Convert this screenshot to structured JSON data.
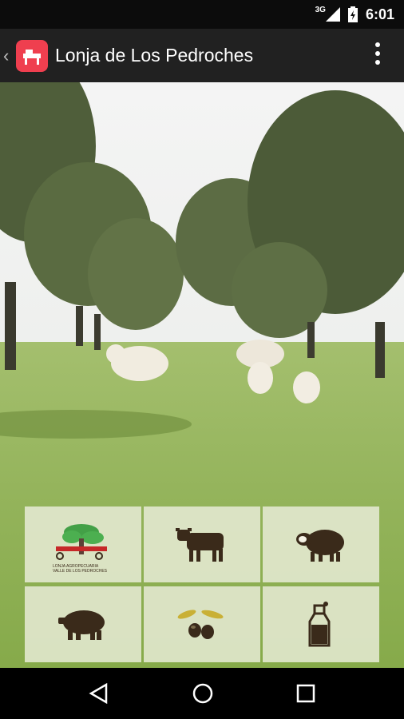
{
  "status_bar": {
    "network": "3G",
    "time": "6:01"
  },
  "action_bar": {
    "title": "Lonja de Los Pedroches"
  },
  "logo": {
    "caption_line1": "LONJA AGROPECUARIA",
    "caption_line2": "VALLE DE LOS PEDROCHES"
  },
  "grid": {
    "items": [
      {
        "name": "logo-tile",
        "icon": "lonja-logo-icon"
      },
      {
        "name": "cattle-tile",
        "icon": "cow-icon"
      },
      {
        "name": "sheep-tile",
        "icon": "sheep-icon"
      },
      {
        "name": "pig-tile",
        "icon": "pig-icon"
      },
      {
        "name": "olive-tile",
        "icon": "olive-icon"
      },
      {
        "name": "milk-tile",
        "icon": "milk-bottle-icon"
      }
    ]
  },
  "nav_bar": {
    "icons": [
      "back-triangle-icon",
      "home-circle-icon",
      "recents-square-icon"
    ]
  },
  "colors": {
    "accent": "#ef3f4f",
    "actionbar": "#212121",
    "icon_brown": "#3a2a1a",
    "logo_green": "#4caf50"
  }
}
